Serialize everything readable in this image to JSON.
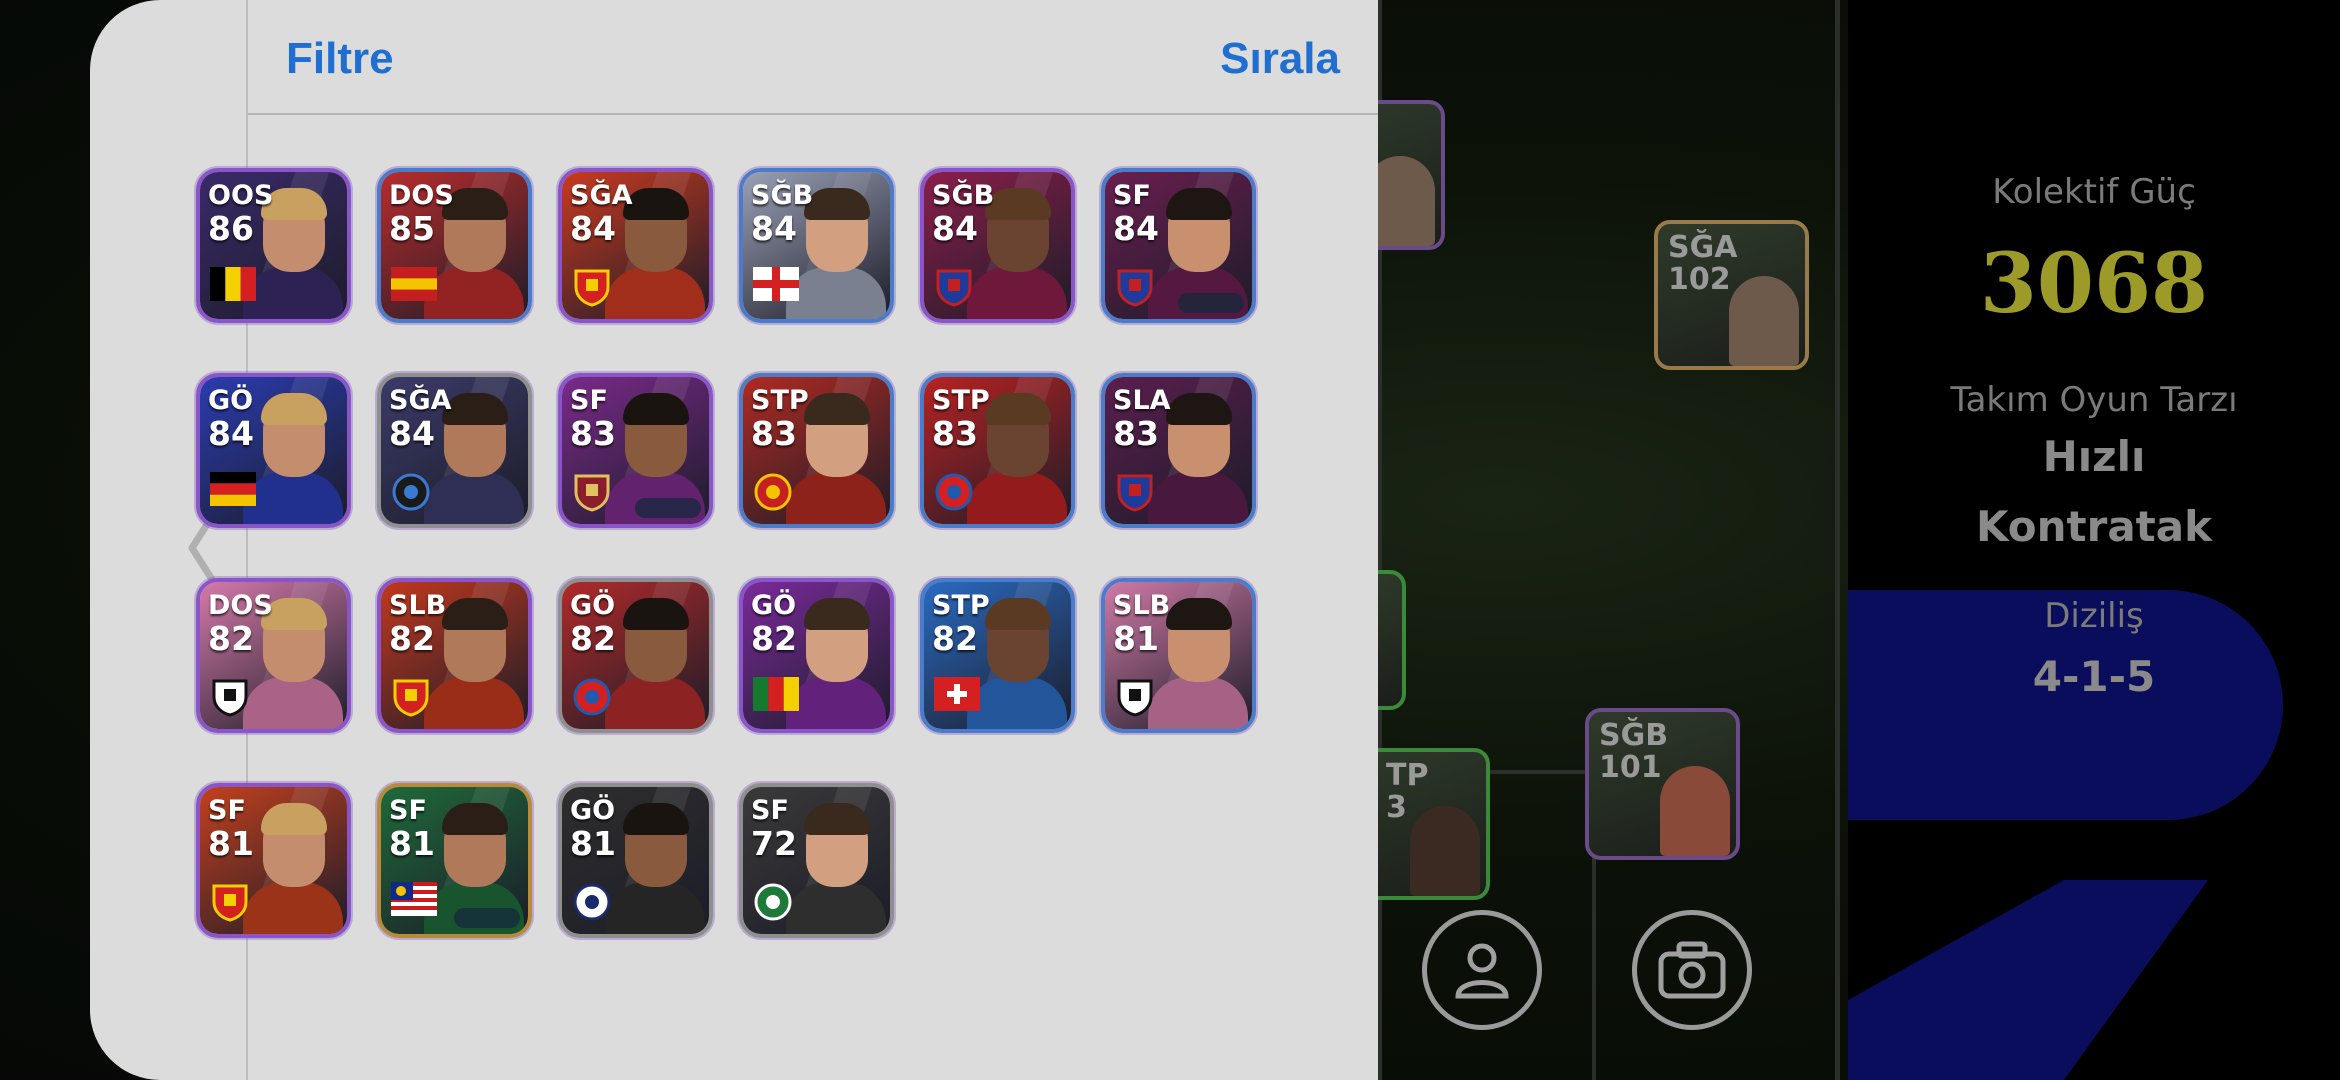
{
  "panel": {
    "filter_label": "Filtre",
    "sort_label": "Sırala"
  },
  "players": [
    {
      "pos": "OOS",
      "ovr": "86",
      "badge": "belgium-flag",
      "frame": "purple",
      "bg": "#3a2a6a"
    },
    {
      "pos": "DOS",
      "ovr": "85",
      "badge": "spain-flag",
      "frame": "blue",
      "bg": "#b82c2c"
    },
    {
      "pos": "SĞA",
      "ovr": "84",
      "badge": "arsenal-crest",
      "frame": "purple",
      "bg": "#c93a20"
    },
    {
      "pos": "SĞB",
      "ovr": "84",
      "badge": "england-flag",
      "frame": "blue",
      "bg": "#9aa0b5"
    },
    {
      "pos": "SĞB",
      "ovr": "84",
      "badge": "barcelona-crest",
      "frame": "purple",
      "bg": "#8a1e4a"
    },
    {
      "pos": "SF",
      "ovr": "84",
      "badge": "barcelona-crest",
      "frame": "blue",
      "bg": "#6a1e50"
    },
    {
      "pos": "GÖ",
      "ovr": "84",
      "badge": "germany-flag",
      "frame": "purple",
      "bg": "#2a3cb0"
    },
    {
      "pos": "SĞA",
      "ovr": "84",
      "badge": "inter-crest",
      "frame": "silver",
      "bg": "#3b3b6a"
    },
    {
      "pos": "SF",
      "ovr": "83",
      "badge": "liverpool-crest",
      "frame": "purple",
      "bg": "#7a2a8a"
    },
    {
      "pos": "STP",
      "ovr": "83",
      "badge": "man-united-crest",
      "frame": "blue",
      "bg": "#b02a22"
    },
    {
      "pos": "STP",
      "ovr": "83",
      "badge": "bayern-crest",
      "frame": "blue",
      "bg": "#b82222"
    },
    {
      "pos": "SLA",
      "ovr": "83",
      "badge": "barcelona-crest",
      "frame": "blue",
      "bg": "#5a1e4e"
    },
    {
      "pos": "DOS",
      "ovr": "82",
      "badge": "sao-paulo-crest",
      "frame": "purple",
      "bg": "#d47aa8"
    },
    {
      "pos": "SLB",
      "ovr": "82",
      "badge": "arsenal-crest",
      "frame": "purple",
      "bg": "#c0381e"
    },
    {
      "pos": "GÖ",
      "ovr": "82",
      "badge": "bayern-crest",
      "frame": "silver",
      "bg": "#b02a2a"
    },
    {
      "pos": "GÖ",
      "ovr": "82",
      "badge": "cameroon-flag",
      "frame": "purple",
      "bg": "#7a2a9a"
    },
    {
      "pos": "STP",
      "ovr": "82",
      "badge": "switzerland-flag",
      "frame": "blue",
      "bg": "#2a6ac0"
    },
    {
      "pos": "SLB",
      "ovr": "81",
      "badge": "sao-paulo-crest",
      "frame": "blue",
      "bg": "#cf7aa6"
    },
    {
      "pos": "SF",
      "ovr": "81",
      "badge": "arsenal-crest",
      "frame": "purple",
      "bg": "#c2401e"
    },
    {
      "pos": "SF",
      "ovr": "81",
      "badge": "malaysia-flag",
      "frame": "gold",
      "bg": "#1e6a3a"
    },
    {
      "pos": "GÖ",
      "ovr": "81",
      "badge": "real-madrid-crest",
      "frame": "silver",
      "bg": "#2e2e2e"
    },
    {
      "pos": "SF",
      "ovr": "72",
      "badge": "club-crest",
      "frame": "silver",
      "bg": "#3a3a3a"
    }
  ],
  "game": {
    "collective_power_label": "Kolektif Güç",
    "collective_power_value": "3068",
    "play_style_label": "Takım Oyun Tarzı",
    "play_style_line1": "Hızlı",
    "play_style_line2": "Kontratak",
    "formation_label": "Diziliş",
    "formation_value": "4-1-5",
    "field_cards": [
      {
        "pos": "SĞA",
        "ovr": "102"
      },
      {
        "pos": "SĞB",
        "ovr": "101"
      },
      {
        "pos": "TP",
        "ovr": "3"
      }
    ]
  },
  "icons": {
    "back": "chevron-left-icon",
    "profile": "person-icon",
    "camera": "camera-icon"
  },
  "colors": {
    "accent_blue": "#1e6fd0",
    "power_yellow": "#9c9b2a",
    "panel_bg": "#dcdcdc",
    "frame_purple": "#8a55c8"
  }
}
